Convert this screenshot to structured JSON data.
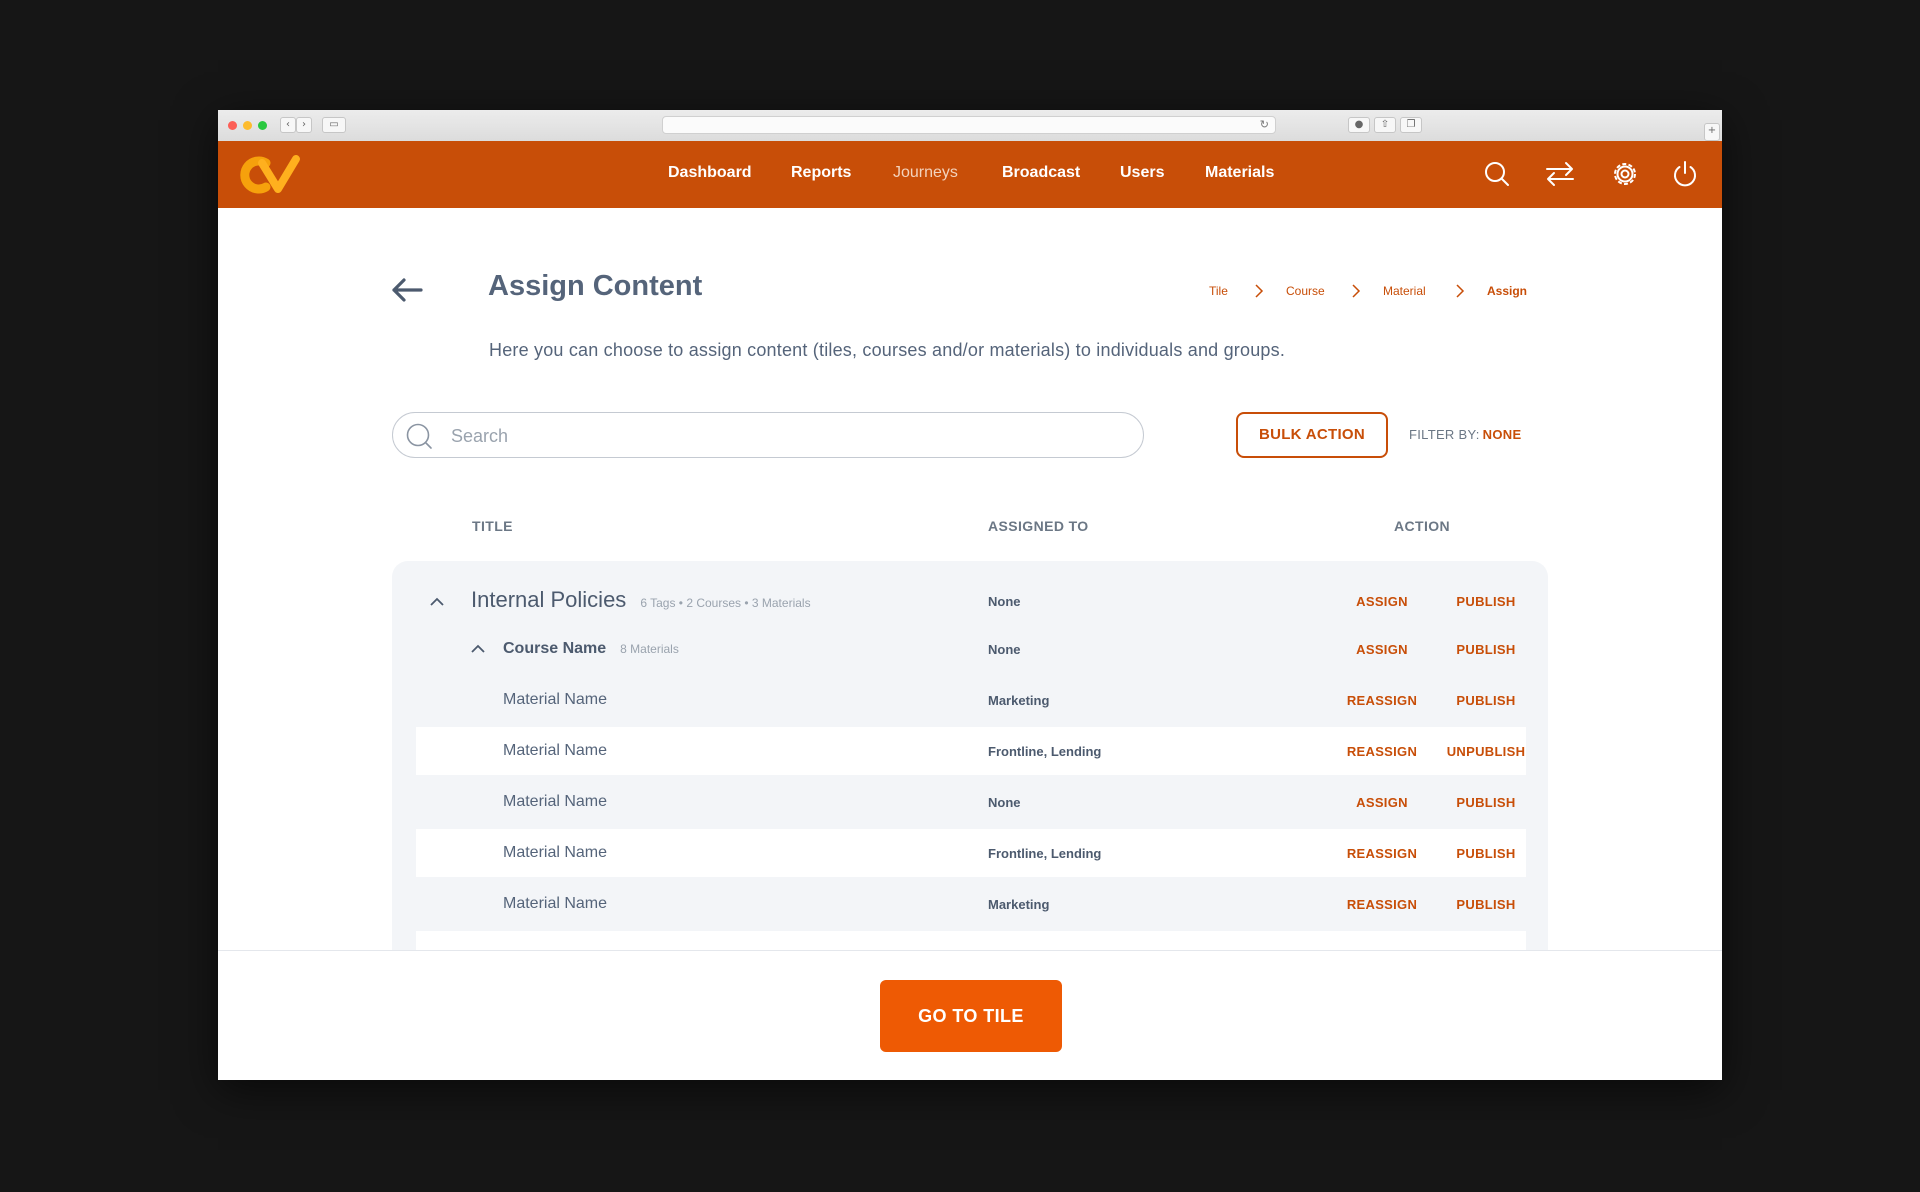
{
  "colors": {
    "brand": "#c84e08",
    "accent_button": "#ee5a04",
    "text": "#55647a",
    "card": "#f3f5f8"
  },
  "nav": {
    "items": [
      {
        "label": "Dashboard"
      },
      {
        "label": "Reports"
      },
      {
        "label": "Journeys"
      },
      {
        "label": "Broadcast"
      },
      {
        "label": "Users"
      },
      {
        "label": "Materials"
      }
    ],
    "icons": [
      "search-icon",
      "swap-arrows-icon",
      "gear-icon",
      "power-icon"
    ]
  },
  "page": {
    "title": "Assign Content",
    "subtitle": "Here you can choose to assign content (tiles, courses and/or materials) to individuals and groups.",
    "breadcrumb": [
      "Tile",
      "Course",
      "Material",
      "Assign"
    ]
  },
  "toolbar": {
    "search_placeholder": "Search",
    "bulk_action_label": "BULK ACTION",
    "filter_label": "FILTER BY:",
    "filter_value": "NONE"
  },
  "table": {
    "headers": {
      "title": "TITLE",
      "assigned_to": "ASSIGNED TO",
      "action": "ACTION"
    },
    "rows": [
      {
        "title": "Internal Policies",
        "meta": "6 Tags  •  2 Courses  •  3 Materials",
        "assigned": "None",
        "action1": "ASSIGN",
        "action2": "PUBLISH"
      },
      {
        "title": "Course Name",
        "meta": "8 Materials",
        "assigned": "None",
        "action1": "ASSIGN",
        "action2": "PUBLISH"
      },
      {
        "title": "Material Name",
        "assigned": "Marketing",
        "action1": "REASSIGN",
        "action2": "PUBLISH"
      },
      {
        "title": "Material Name",
        "assigned": "Frontline, Lending",
        "action1": "REASSIGN",
        "action2": "UNPUBLISH"
      },
      {
        "title": "Material Name",
        "assigned": "None",
        "action1": "ASSIGN",
        "action2": "PUBLISH"
      },
      {
        "title": "Material Name",
        "assigned": "Frontline, Lending",
        "action1": "REASSIGN",
        "action2": "PUBLISH"
      },
      {
        "title": "Material Name",
        "assigned": "Marketing",
        "action1": "REASSIGN",
        "action2": "PUBLISH"
      }
    ]
  },
  "footer": {
    "button_label": "GO TO TILE"
  }
}
